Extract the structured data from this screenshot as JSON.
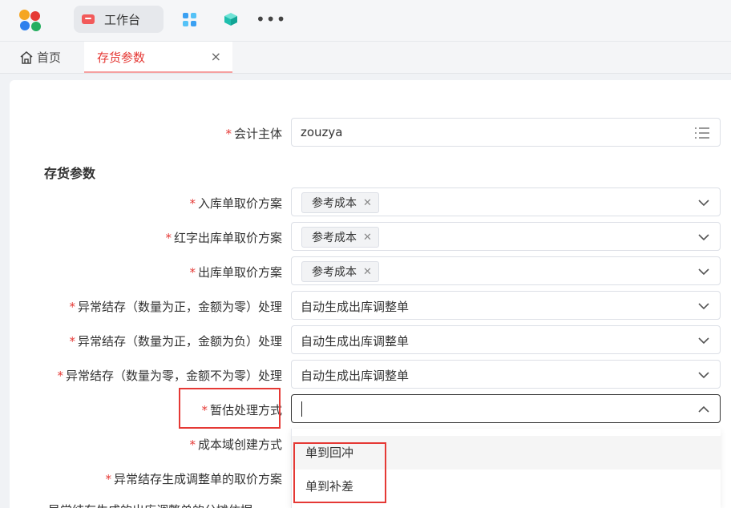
{
  "topbar": {
    "workbench_label": "工作台",
    "icons": [
      "app-logo-icon",
      "workbench-icon",
      "apps-grid-icon",
      "cube-icon",
      "more-icon"
    ],
    "more_label": "•••"
  },
  "tabs": {
    "home_label": "首页",
    "active_label": "存货参数",
    "close_label": "×"
  },
  "form": {
    "accounting_entity": {
      "label": "会计主体",
      "value": "zouzya"
    },
    "section_title": "存货参数",
    "rows": [
      {
        "label": "入库单取价方案",
        "tag": "参考成本"
      },
      {
        "label": "红字出库单取价方案",
        "tag": "参考成本"
      },
      {
        "label": "出库单取价方案",
        "tag": "参考成本"
      },
      {
        "label": "异常结存（数量为正，金额为零）处理",
        "value": "自动生成出库调整单"
      },
      {
        "label": "异常结存（数量为正，金额为负）处理",
        "value": "自动生成出库调整单"
      },
      {
        "label": "异常结存（数量为零，金额不为零）处理",
        "value": "自动生成出库调整单"
      }
    ],
    "estimate_method": {
      "label": "暂估处理方式",
      "value": ""
    },
    "cost_domain": {
      "label": "成本域创建方式"
    },
    "abnormal_price": {
      "label": "异常结存生成调整单的取价方案"
    },
    "cut_label": "异常结存生成的出库调整单的分摊依据"
  },
  "dropdown": {
    "options": [
      "单到回冲",
      "单到补差"
    ]
  },
  "required_mark": "*",
  "colors": {
    "accent": "#e53935",
    "tag_bg": "#f2f3f5"
  }
}
